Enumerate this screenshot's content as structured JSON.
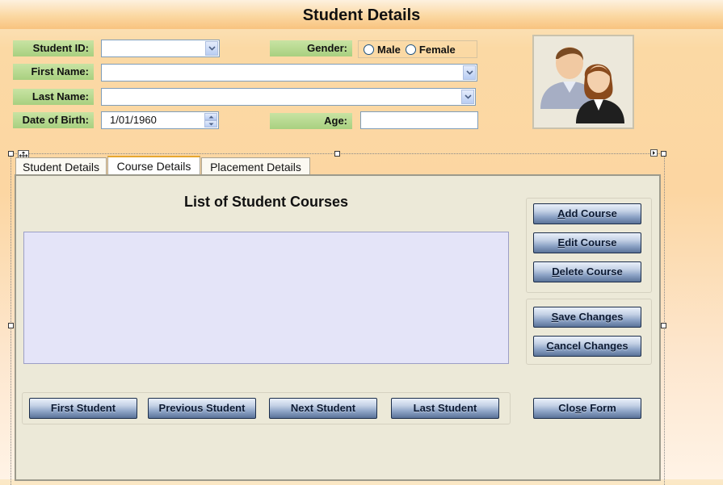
{
  "form": {
    "title": "Student Details"
  },
  "fields": {
    "student_id": {
      "label": "Student ID:",
      "value": ""
    },
    "gender": {
      "label": "Gender:",
      "options": [
        "Male",
        "Female"
      ]
    },
    "first_name": {
      "label": "First Name:",
      "value": ""
    },
    "last_name": {
      "label": "Last Name:",
      "value": ""
    },
    "dob": {
      "label": "Date of Birth:",
      "value": "1/01/1960"
    },
    "age": {
      "label": "Age:",
      "value": ""
    }
  },
  "tabs": [
    {
      "label": "Student Details"
    },
    {
      "label": "Course Details"
    },
    {
      "label": "Placement Details"
    }
  ],
  "active_tab": "Course Details",
  "course_panel": {
    "heading": "List of Student Courses",
    "buttons": {
      "add": {
        "pre": "",
        "u": "A",
        "post": "dd Course"
      },
      "edit": {
        "pre": "",
        "u": "E",
        "post": "dit Course"
      },
      "delete": {
        "pre": "",
        "u": "D",
        "post": "elete Course"
      },
      "save": {
        "pre": "",
        "u": "S",
        "post": "ave Changes"
      },
      "cancel": {
        "pre": "",
        "u": "C",
        "post": "ancel Changes"
      },
      "close": {
        "pre": "Clo",
        "u": "s",
        "post": "e Form"
      }
    },
    "nav": {
      "first": "First Student",
      "previous": "Previous Student",
      "next": "Next Student",
      "last": "Last Student"
    }
  },
  "colors": {
    "label_green": "#b4d88c",
    "button_blue": "#5b7399",
    "list_bg": "#e4e4f8",
    "panel_bg": "#ece9d8"
  },
  "icons": {
    "photo": "people-icon",
    "dropdown": "chevron-down-icon",
    "spinner": "spin-arrows-icon",
    "move": "move-handle-icon"
  }
}
